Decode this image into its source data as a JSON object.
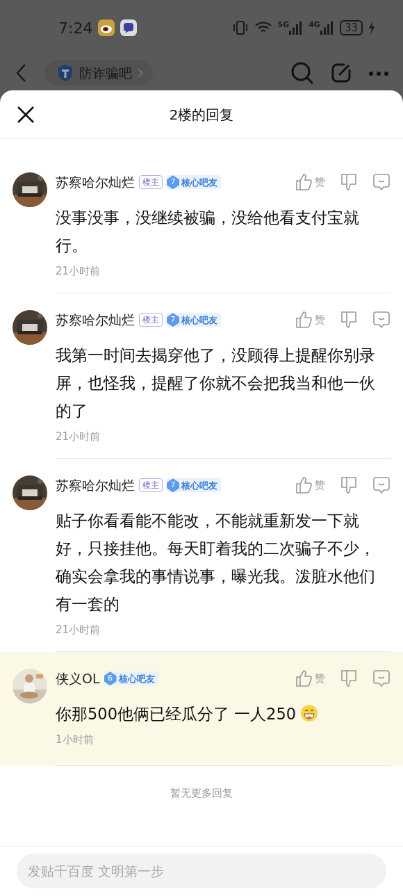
{
  "status_bar": {
    "time": "7:24",
    "network_labels": [
      "5G",
      "4G"
    ],
    "battery": "33"
  },
  "nav": {
    "forum": "防诈骗吧"
  },
  "sheet": {
    "title": "2楼的回复"
  },
  "replies": [
    {
      "author": "苏察哈尔灿烂",
      "owner_tag": "楼主",
      "level": "7",
      "rank": "核心吧友",
      "text": "没事没事，没继续被骗，没给他看支付宝就行。",
      "time": "21小时前",
      "like": "赞",
      "highlighted": false,
      "emoji": false
    },
    {
      "author": "苏察哈尔灿烂",
      "owner_tag": "楼主",
      "level": "7",
      "rank": "核心吧友",
      "text": "我第一时间去揭穿他了，没顾得上提醒你别录屏，也怪我，提醒了你就不会把我当和他一伙的了",
      "time": "21小时前",
      "like": "赞",
      "highlighted": false,
      "emoji": false
    },
    {
      "author": "苏察哈尔灿烂",
      "owner_tag": "楼主",
      "level": "7",
      "rank": "核心吧友",
      "text": "贴子你看看能不能改，不能就重新发一下就好，只接挂他。每天盯着我的二次骗子不少，确实会拿我的事情说事，曝光我。泼脏水他们有一套的",
      "time": "21小时前",
      "like": "赞",
      "highlighted": false,
      "emoji": false
    },
    {
      "author": "侠义OL",
      "level": "6",
      "rank": "核心吧友",
      "text": "你那500他俩已经瓜分了 一人250",
      "time": "1小时前",
      "like": "赞",
      "highlighted": true,
      "emoji": true
    }
  ],
  "end_note": "暂无更多回复",
  "composer": {
    "placeholder": "发贴千百度 文明第一步"
  }
}
